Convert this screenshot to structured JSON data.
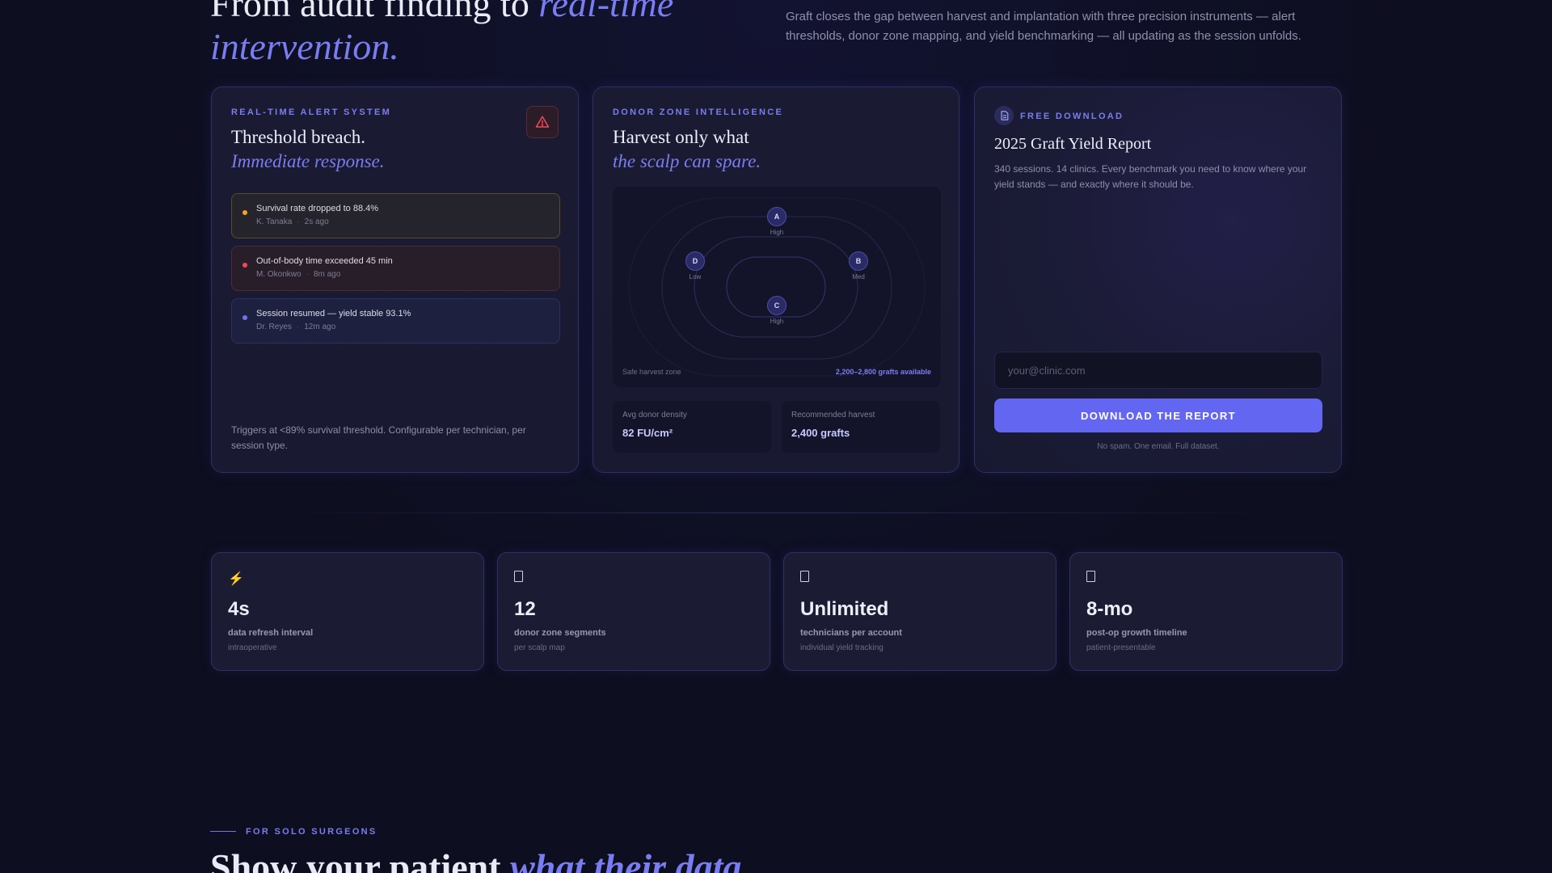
{
  "hero": {
    "title_line1": "From audit finding to ",
    "title_line1_accent": "real-time",
    "title_line2_accent": "intervention.",
    "description": "Graft closes the gap between harvest and implantation with three precision instruments — alert thresholds, donor zone mapping, and yield benchmarking — all updating as the session unfolds."
  },
  "alert_card": {
    "eyebrow": "REAL-TIME ALERT SYSTEM",
    "heading": "Threshold breach.",
    "heading_accent": "Immediate response.",
    "icon": "warning-triangle-icon",
    "alerts": [
      {
        "message": "Survival rate dropped to 88.4%",
        "author": "K. Tanaka",
        "time": "2s ago",
        "severity": "warning",
        "color": "#f5a524"
      },
      {
        "message": "Out-of-body time exceeded 45 min",
        "author": "M. Okonkwo",
        "time": "8m ago",
        "severity": "critical",
        "color": "#ef4a55"
      },
      {
        "message": "Session resumed — yield stable 93.1%",
        "author": "Dr. Reyes",
        "time": "12m ago",
        "severity": "info",
        "color": "#6f73f2"
      }
    ],
    "footer": "Triggers at <89% survival threshold. Configurable per technician, per session type."
  },
  "donor_card": {
    "eyebrow": "DONOR ZONE INTELLIGENCE",
    "heading": "Harvest only what",
    "heading_accent": "the scalp can spare.",
    "zones": [
      {
        "id": "A",
        "level": "High"
      },
      {
        "id": "B",
        "level": "Med"
      },
      {
        "id": "C",
        "level": "High"
      },
      {
        "id": "D",
        "level": "Low"
      }
    ],
    "map_footer_left": "Safe harvest zone",
    "map_footer_right": "2,200–2,800 grafts available",
    "stats": [
      {
        "label": "Avg donor density",
        "value": "82 FU/cm²"
      },
      {
        "label": "Recommended harvest",
        "value": "2,400 grafts"
      }
    ]
  },
  "report_card": {
    "eyebrow": "FREE DOWNLOAD",
    "icon": "document-icon",
    "title": "2025 Graft Yield Report",
    "description": "340 sessions. 14 clinics. Every benchmark you need to know where your yield stands — and exactly where it should be.",
    "email_placeholder": "your@clinic.com",
    "email_value": "",
    "button_label": "DOWNLOAD THE REPORT",
    "note": "No spam. One email. Full dataset."
  },
  "metrics": [
    {
      "icon": "lightning-icon",
      "glyph": "⚡",
      "value": "4s",
      "label": "data refresh interval",
      "sub": "intraoperative"
    },
    {
      "icon": "box-icon",
      "glyph": "",
      "value": "12",
      "label": "donor zone segments",
      "sub": "per scalp map"
    },
    {
      "icon": "box-icon",
      "glyph": "",
      "value": "Unlimited",
      "label": "technicians per account",
      "sub": "individual yield tracking"
    },
    {
      "icon": "box-icon",
      "glyph": "",
      "value": "8-mo",
      "label": "post-op growth timeline",
      "sub": "patient-presentable"
    }
  ],
  "solo_section": {
    "eyebrow": "FOR SOLO SURGEONS",
    "title": "Show your patient ",
    "title_accent": "what their data"
  },
  "colors": {
    "background": "#0d0e1f",
    "accent": "#7a7df0",
    "button": "#6366f1",
    "card_border": "#2f2f66"
  }
}
